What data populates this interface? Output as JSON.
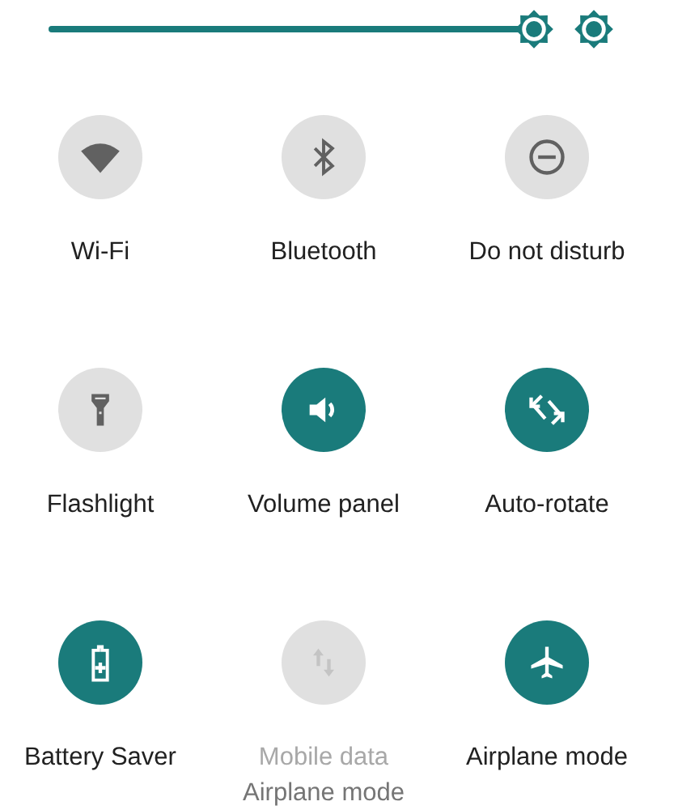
{
  "brightness": {
    "level": 1,
    "auto": true
  },
  "tiles": [
    {
      "kind": "wifi",
      "label": "Wi-Fi",
      "on": false,
      "disabled": false
    },
    {
      "kind": "bluetooth",
      "label": "Bluetooth",
      "on": false,
      "disabled": false
    },
    {
      "kind": "dnd",
      "label": "Do not disturb",
      "on": false,
      "disabled": false
    },
    {
      "kind": "flashlight",
      "label": "Flashlight",
      "on": false,
      "disabled": false
    },
    {
      "kind": "volume",
      "label": "Volume panel",
      "on": true,
      "disabled": false
    },
    {
      "kind": "rotate",
      "label": "Auto-rotate",
      "on": true,
      "disabled": false
    },
    {
      "kind": "battery",
      "label": "Battery Saver",
      "on": true,
      "disabled": false
    },
    {
      "kind": "data",
      "label": "Mobile data",
      "on": false,
      "disabled": true,
      "subtitle": "Airplane mode"
    },
    {
      "kind": "airplane",
      "label": "Airplane mode",
      "on": true,
      "disabled": false
    }
  ]
}
